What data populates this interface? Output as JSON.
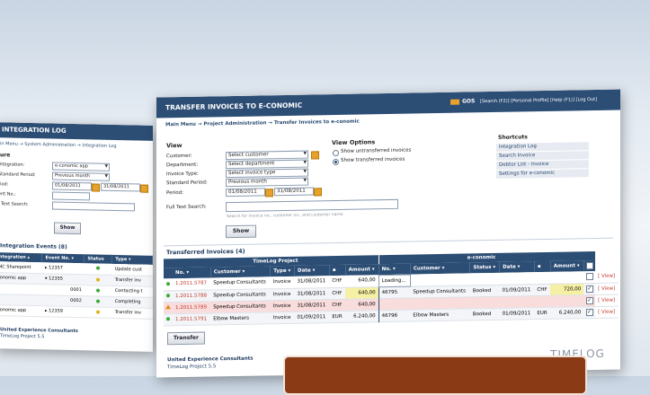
{
  "left": {
    "title": "INTEGRATION LOG",
    "breadcrumb": "in Menu → System Administration → Integration Log",
    "filter_heading": "ure",
    "filters": [
      {
        "label": "Integration:",
        "value": "e-conomic app",
        "kind": "select"
      },
      {
        "label": "Standard Period:",
        "value": "Previous month",
        "kind": "select"
      },
      {
        "label": "riod:",
        "from": "01/08/2011",
        "to": "31/08/2011",
        "kind": "date"
      },
      {
        "label": "ent No.:",
        "value": "",
        "kind": "input"
      },
      {
        "label": "l Text Search:",
        "value": "",
        "kind": "input"
      }
    ],
    "show_button": "Show",
    "events_title": "Integration Events (8)",
    "columns": [
      "Integration ▴",
      "Event No. ▾",
      "Status",
      "Type ▾"
    ],
    "rows": [
      {
        "integration": "INC Sharepoint",
        "event": "▸ 12357",
        "status_color": "#3aa935",
        "type": "Update cust"
      },
      {
        "integration": "conomic app",
        "event": "▾ 12355",
        "status_color": "#e3b21a",
        "type": "Transfer inv"
      },
      {
        "integration": "",
        "event": "0001",
        "status_color": "#3aa935",
        "type": "Contacting t"
      },
      {
        "integration": "",
        "event": "0002",
        "status_color": "#3aa935",
        "type": "Completing"
      },
      {
        "integration": "conomic app",
        "event": "▸ 12359",
        "status_color": "#e3b21a",
        "type": "Transfer inv"
      }
    ],
    "footer_company": "United Experience Consultants",
    "footer_version": "TimeLog Project 5.5"
  },
  "main": {
    "title": "TRANSFER INVOICES TO E-CONOMIC",
    "user": "GOS",
    "top_links": "[Search (F2)] [Personal Profile] [Help (F1)] [Log Out]",
    "breadcrumb": "Main Menu → Project Administration → Transfer Invoices to e-conomic",
    "view_heading": "View",
    "view_fields": [
      {
        "label": "Customer:",
        "value": "Select customer",
        "kind": "select",
        "icon": true
      },
      {
        "label": "Department:",
        "value": "Select department",
        "kind": "select"
      },
      {
        "label": "Invoice Type:",
        "value": "Select invoice type",
        "kind": "select"
      },
      {
        "label": "Standard Period:",
        "value": "Previous month",
        "kind": "select"
      }
    ],
    "period": {
      "label": "Period:",
      "from": "01/08/2011",
      "to": "31/08/2011"
    },
    "search": {
      "label": "Full Text Search:",
      "value": "",
      "hint": "Search for invoice no., customer no., and customer name"
    },
    "show_button": "Show",
    "view_options": {
      "heading": "View Options",
      "options": [
        {
          "label": "Show untransferred invoices",
          "selected": false
        },
        {
          "label": "Show transferred invoices",
          "selected": true
        }
      ]
    },
    "shortcuts": {
      "heading": "Shortcuts",
      "items": [
        "Integration Log",
        "Search Invoice",
        "Debtor List - Invoice",
        "Settings for e-conomic"
      ]
    },
    "grid_title": "Transferred Invoices (4)",
    "group_timelog": "TimeLog Project",
    "group_economic": "e-conomic",
    "columns": [
      "No. ▾",
      "Customer ▾",
      "Type ▾",
      "Date ▾",
      "▪",
      "Amount ▾",
      "No. ▾",
      "Customer ▾",
      "Status ▾",
      "Date ▾",
      "▪",
      "Amount ▾"
    ],
    "view_link": "[ View]",
    "rows": [
      {
        "status": "ok",
        "no": "1.2011.5787",
        "customer": "Speedup Consultants",
        "type": "Invoice",
        "date": "31/08/2011",
        "cur": "CHF",
        "amount": "640,00",
        "e_no": "Loading…",
        "e_customer": "",
        "e_status": "",
        "e_date": "",
        "e_cur": "",
        "e_amount": "",
        "checked": false,
        "warn_bg": false
      },
      {
        "status": "ok",
        "no": "1.2011.5788",
        "customer": "Speedup Consultants",
        "type": "Invoice",
        "date": "31/08/2011",
        "cur": "CHF",
        "amount": "640,00",
        "e_no": "46795",
        "e_customer": "Speedup Consultants",
        "e_status": "Booked",
        "e_date": "01/09/2011",
        "e_cur": "CHF",
        "e_amount": "720,00",
        "checked": true,
        "warn_bg": false
      },
      {
        "status": "warn",
        "no": "1.2011.5789",
        "customer": "Speedup Consultants",
        "type": "Invoice",
        "date": "31/08/2011",
        "cur": "CHF",
        "amount": "640,00",
        "e_no": "",
        "e_customer": "",
        "e_status": "",
        "e_date": "",
        "e_cur": "",
        "e_amount": "",
        "checked": true,
        "warn_bg": true
      },
      {
        "status": "ok",
        "no": "1.2011.5791",
        "customer": "Elbow Masters",
        "type": "Invoice",
        "date": "01/09/2011",
        "cur": "EUR",
        "amount": "6.240,00",
        "e_no": "46796",
        "e_customer": "Elbow Masters",
        "e_status": "Booked",
        "e_date": "01/09/2011",
        "e_cur": "EUR",
        "e_amount": "6.240,00",
        "checked": true,
        "warn_bg": false
      }
    ],
    "transfer_button": "Transfer",
    "footer_company": "United Experience Consultants",
    "footer_version": "TimeLog Project 5.5",
    "logo": "TIMELOG"
  },
  "colors": {
    "header": "#2c4d74",
    "ok": "#3aa935",
    "warn": "#e08a1a",
    "highlight": "#f6f0a4",
    "warn_row": "#f9dcdc",
    "overlay": "#8a3b16"
  }
}
